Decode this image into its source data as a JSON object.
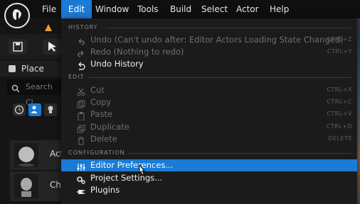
{
  "menu": {
    "items": [
      {
        "label": "File"
      },
      {
        "label": "Edit"
      },
      {
        "label": "Window"
      },
      {
        "label": "Tools"
      },
      {
        "label": "Build"
      },
      {
        "label": "Select"
      },
      {
        "label": "Actor"
      },
      {
        "label": "Help"
      }
    ],
    "active": "Edit"
  },
  "left_panel": {
    "place_actors_label": "Place Actor",
    "search_placeholder": "Search Cl",
    "actors": [
      {
        "label": "Act"
      },
      {
        "label": "Cha"
      }
    ]
  },
  "dropdown": {
    "sections": {
      "history": "HISTORY",
      "edit": "EDIT",
      "configuration": "CONFIGURATION"
    },
    "history_items": [
      {
        "label": "Undo (Can't undo after: Editor Actors Loading State Changed)",
        "shortcut": "CTRL+Z",
        "icon": "undo-icon"
      },
      {
        "label": "Redo (Nothing to redo)",
        "shortcut": "CTRL+Y",
        "icon": "redo-icon"
      },
      {
        "label": "Undo History",
        "shortcut": "",
        "icon": "history-icon"
      }
    ],
    "edit_items": [
      {
        "label": "Cut",
        "shortcut": "CTRL+X",
        "icon": "cut-icon"
      },
      {
        "label": "Copy",
        "shortcut": "CTRL+C",
        "icon": "copy-icon"
      },
      {
        "label": "Paste",
        "shortcut": "CTRL+V",
        "icon": "paste-icon"
      },
      {
        "label": "Duplicate",
        "shortcut": "CTRL+D",
        "icon": "duplicate-icon"
      },
      {
        "label": "Delete",
        "shortcut": "DELETE",
        "icon": "delete-icon"
      }
    ],
    "config_items": [
      {
        "label": "Editor Preferences...",
        "icon": "sliders-icon"
      },
      {
        "label": "Project Settings...",
        "icon": "gears-icon"
      },
      {
        "label": "Plugins",
        "icon": "plug-icon"
      }
    ]
  },
  "colors": {
    "accent": "#1a7ad4",
    "menu_bg": "#1b1b1b"
  }
}
